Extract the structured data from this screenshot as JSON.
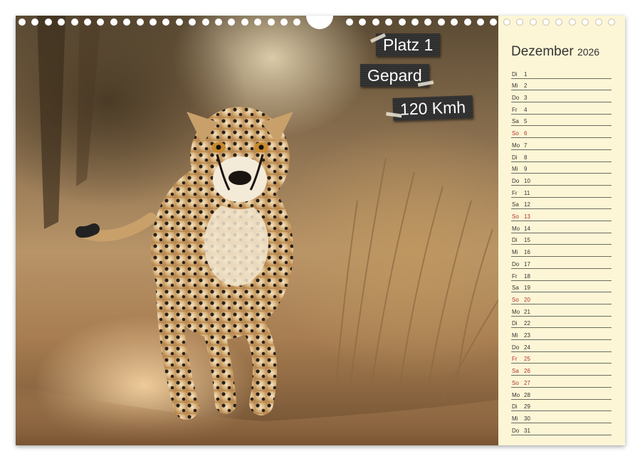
{
  "photo": {
    "labels": [
      {
        "id": "rank",
        "text": "Platz 1"
      },
      {
        "id": "animal",
        "text": "Gepard"
      },
      {
        "id": "speed",
        "text": "120 Kmh"
      }
    ]
  },
  "planner": {
    "month": "Dezember",
    "year": "2026",
    "accent_color": "#b0352a",
    "days": [
      {
        "wd": "Di",
        "n": "1",
        "red": false
      },
      {
        "wd": "Mi",
        "n": "2",
        "red": false
      },
      {
        "wd": "Do",
        "n": "3",
        "red": false
      },
      {
        "wd": "Fr",
        "n": "4",
        "red": false
      },
      {
        "wd": "Sa",
        "n": "5",
        "red": false
      },
      {
        "wd": "So",
        "n": "6",
        "red": true
      },
      {
        "wd": "Mo",
        "n": "7",
        "red": false
      },
      {
        "wd": "Di",
        "n": "8",
        "red": false
      },
      {
        "wd": "Mi",
        "n": "9",
        "red": false
      },
      {
        "wd": "Do",
        "n": "10",
        "red": false
      },
      {
        "wd": "Fr",
        "n": "11",
        "red": false
      },
      {
        "wd": "Sa",
        "n": "12",
        "red": false
      },
      {
        "wd": "So",
        "n": "13",
        "red": true
      },
      {
        "wd": "Mo",
        "n": "14",
        "red": false
      },
      {
        "wd": "Di",
        "n": "15",
        "red": false
      },
      {
        "wd": "Mi",
        "n": "16",
        "red": false
      },
      {
        "wd": "Do",
        "n": "17",
        "red": false
      },
      {
        "wd": "Fr",
        "n": "18",
        "red": false
      },
      {
        "wd": "Sa",
        "n": "19",
        "red": false
      },
      {
        "wd": "So",
        "n": "20",
        "red": true
      },
      {
        "wd": "Mo",
        "n": "21",
        "red": false
      },
      {
        "wd": "Di",
        "n": "22",
        "red": false
      },
      {
        "wd": "Mi",
        "n": "23",
        "red": false
      },
      {
        "wd": "Do",
        "n": "24",
        "red": false
      },
      {
        "wd": "Fr",
        "n": "25",
        "red": true
      },
      {
        "wd": "Sa",
        "n": "26",
        "red": true
      },
      {
        "wd": "So",
        "n": "27",
        "red": true
      },
      {
        "wd": "Mo",
        "n": "28",
        "red": false
      },
      {
        "wd": "Di",
        "n": "29",
        "red": false
      },
      {
        "wd": "Mi",
        "n": "30",
        "red": false
      },
      {
        "wd": "Do",
        "n": "31",
        "red": false
      }
    ]
  }
}
